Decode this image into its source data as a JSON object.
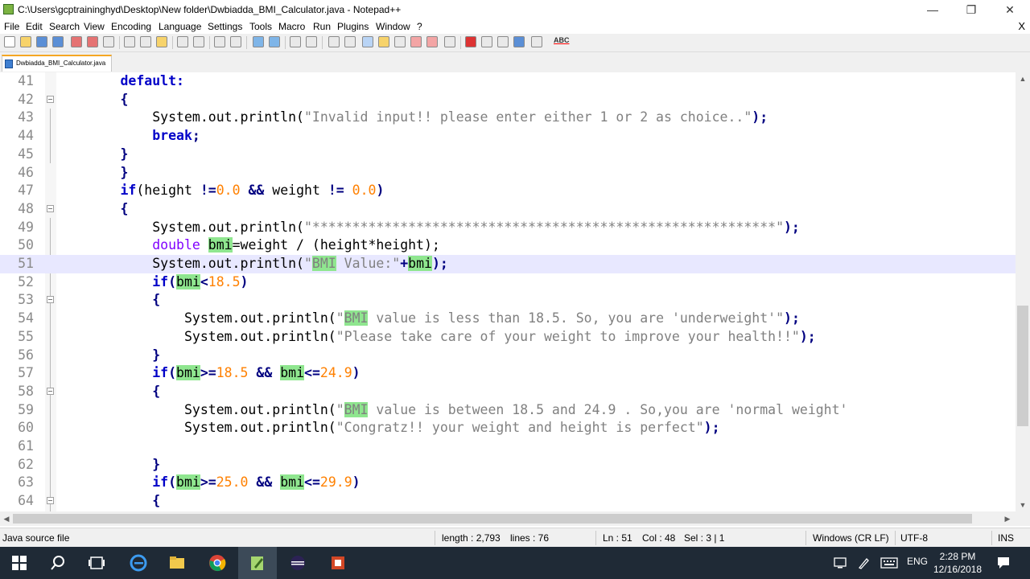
{
  "window": {
    "title": "C:\\Users\\gcptraininghyd\\Desktop\\New folder\\Dwbiadda_BMI_Calculator.java - Notepad++",
    "minimize": "—",
    "maximize": "❐",
    "close": "✕"
  },
  "menu": {
    "items": [
      "File",
      "Edit",
      "Search",
      "View",
      "Encoding",
      "Language",
      "Settings",
      "Tools",
      "Macro",
      "Run",
      "Plugins",
      "Window",
      "?"
    ],
    "close_doc": "X"
  },
  "toolbar": {
    "spellcheck": "ABC"
  },
  "tabs": [
    {
      "label": "Dwbiadda_BMI_Calculator.java"
    }
  ],
  "editor": {
    "current_line": "51",
    "lines": [
      {
        "n": "41"
      },
      {
        "n": "42"
      },
      {
        "n": "43"
      },
      {
        "n": "44"
      },
      {
        "n": "45"
      },
      {
        "n": "46"
      },
      {
        "n": "47"
      },
      {
        "n": "48"
      },
      {
        "n": "49"
      },
      {
        "n": "50"
      },
      {
        "n": "51"
      },
      {
        "n": "52"
      },
      {
        "n": "53"
      },
      {
        "n": "54"
      },
      {
        "n": "55"
      },
      {
        "n": "56"
      },
      {
        "n": "57"
      },
      {
        "n": "58"
      },
      {
        "n": "59"
      },
      {
        "n": "60"
      },
      {
        "n": "61"
      },
      {
        "n": "62"
      },
      {
        "n": "63"
      },
      {
        "n": "64"
      }
    ],
    "code": {
      "l41": {
        "kw": "default:"
      },
      "l42": {
        "p": "{"
      },
      "l43": {
        "a": "System.out.println(",
        "s": "\"Invalid input!! please enter either 1 or 2 as choice..\"",
        "b": ");"
      },
      "l44": {
        "kw": "break",
        "b": ";"
      },
      "l45": {
        "p": "}"
      },
      "l46": {
        "p": "}"
      },
      "l47": {
        "kw": "if",
        "a": "(height ",
        "op1": "!=",
        "n1": "0.0",
        "op2": " && ",
        "c": "weight ",
        "op3": "!= ",
        "n2": "0.0",
        "b": ")"
      },
      "l48": {
        "p": "{"
      },
      "l49": {
        "a": "System.out.println(",
        "s": "\"**********************************************************\"",
        "b": ");"
      },
      "l50": {
        "t": "double",
        "sp": " ",
        "v": "bmi",
        "a": "=weight / (height*height);"
      },
      "l51": {
        "a": "System.out.println(",
        "q": "\"",
        "v1": "BMI",
        "s": " Value:\"",
        "plus": "+",
        "v2": "bmi",
        "b": ");"
      },
      "l52": {
        "kw": "if",
        "a": "(",
        "v": "bmi",
        "op": "<",
        "n": "18.5",
        "b": ")"
      },
      "l53": {
        "p": "{"
      },
      "l54": {
        "a": "System.out.println(",
        "q": "\"",
        "v": "BMI",
        "s": " value is less than 18.5. So, you are 'underweight'\"",
        "b": ");"
      },
      "l55": {
        "a": "System.out.println(",
        "s": "\"Please take care of your weight to improve your health!!\"",
        "b": ");"
      },
      "l56": {
        "p": "}"
      },
      "l57": {
        "kw": "if",
        "a": "(",
        "v1": "bmi",
        "op1": ">=",
        "n1": "18.5",
        "op2": " && ",
        "v2": "bmi",
        "op3": "<=",
        "n2": "24.9",
        "b": ")"
      },
      "l58": {
        "p": "{"
      },
      "l59": {
        "a": "System.out.println(",
        "q": "\"",
        "v": "BMI",
        "s": " value is between 18.5 and 24.9 . So,you are 'normal weight'"
      },
      "l60": {
        "a": "System.out.println(",
        "s": "\"Congratz!! your weight and height is perfect\"",
        "b": ");"
      },
      "l61": {
        "p": ""
      },
      "l62": {
        "p": "}"
      },
      "l63": {
        "kw": "if",
        "a": "(",
        "v1": "bmi",
        "op1": ">=",
        "n1": "25.0",
        "op2": " && ",
        "v2": "bmi",
        "op3": "<=",
        "n2": "29.9",
        "b": ")"
      },
      "l64": {
        "p": "{"
      }
    }
  },
  "status": {
    "filetype": "Java source file",
    "length": "length : 2,793",
    "lines": "lines : 76",
    "ln": "Ln : 51",
    "col": "Col : 48",
    "sel": "Sel : 3 | 1",
    "eol": "Windows (CR LF)",
    "encoding": "UTF-8",
    "mode": "INS"
  },
  "taskbar": {
    "lang": "ENG",
    "time": "2:28 PM",
    "date": "12/16/2018"
  },
  "colors": {
    "keyword": "#0000c8",
    "type": "#8000ff",
    "string": "#808080",
    "number": "#ff8000",
    "highlight": "#8fe68f",
    "current_line": "#e8e8ff"
  }
}
